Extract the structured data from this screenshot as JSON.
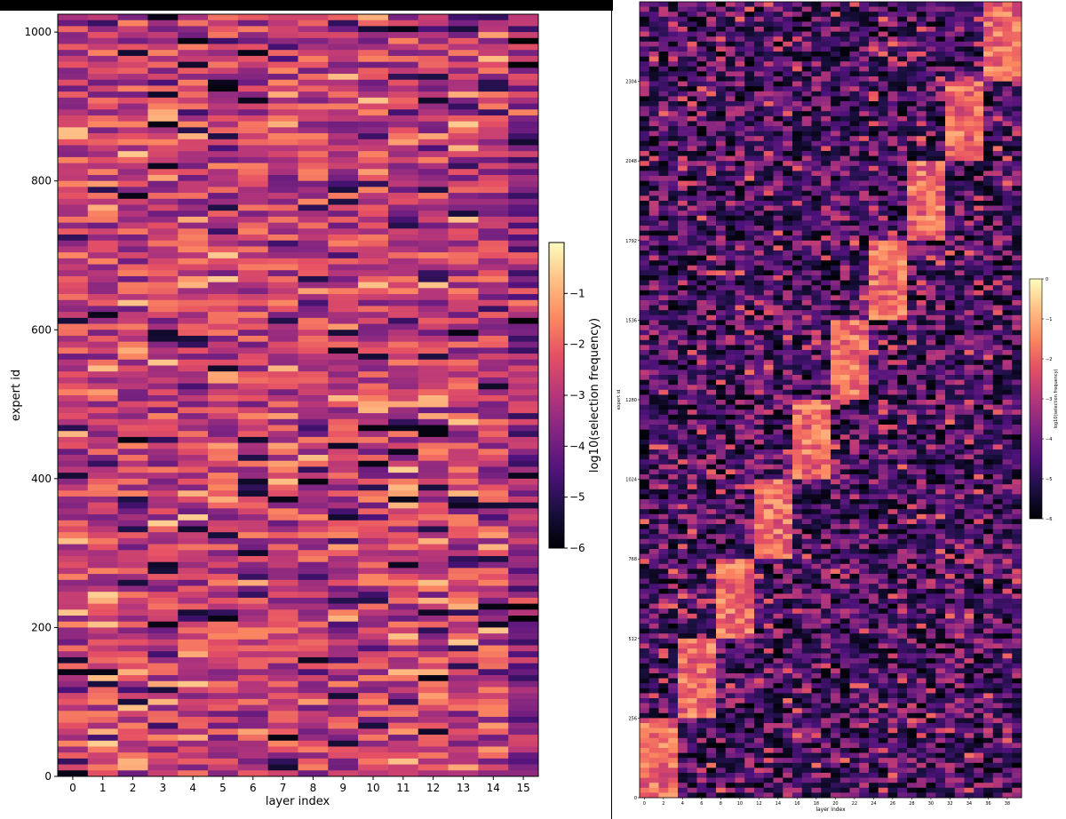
{
  "chart_data": [
    {
      "type": "heatmap",
      "xlabel": "layer index",
      "ylabel": "expert id",
      "x_tick_labels": [
        "0",
        "1",
        "2",
        "3",
        "4",
        "5",
        "6",
        "7",
        "8",
        "9",
        "10",
        "11",
        "12",
        "13",
        "14",
        "15"
      ],
      "y_tick_labels": [
        "0",
        "200",
        "400",
        "600",
        "800",
        "1000"
      ],
      "y_ticks": [
        0,
        200,
        400,
        600,
        800,
        1000
      ],
      "xlim": [
        -0.5,
        15.5
      ],
      "ylim": [
        0,
        1024
      ],
      "colormap": "magma",
      "colorbar": {
        "label": "log10(selection frequency)",
        "tick_labels": [
          "−1",
          "−2",
          "−3",
          "−4",
          "−5",
          "−6"
        ],
        "ticks": [
          -1,
          -2,
          -3,
          -4,
          -5,
          -6
        ],
        "range": [
          -6,
          0
        ]
      },
      "pattern": "uniform usage across all experts in every layer; values mostly between -4 and -1.5, last layer slightly darker"
    },
    {
      "type": "heatmap",
      "xlabel": "layer index",
      "ylabel": "expert id",
      "x_tick_labels": [
        "0",
        "2",
        "4",
        "6",
        "8",
        "10",
        "12",
        "14",
        "16",
        "18",
        "20",
        "22",
        "24",
        "26",
        "28",
        "30",
        "32",
        "34",
        "36",
        "38"
      ],
      "y_tick_labels": [
        "0",
        "256",
        "512",
        "768",
        "1024",
        "1280",
        "1536",
        "1792",
        "2048",
        "2304"
      ],
      "y_ticks": [
        0,
        256,
        512,
        768,
        1024,
        1280,
        1536,
        1792,
        2048,
        2304
      ],
      "xlim": [
        -0.5,
        39.5
      ],
      "ylim": [
        0,
        2560
      ],
      "colormap": "magma",
      "colorbar": {
        "label": "log10(selection frequency)",
        "tick_labels": [
          "0",
          "−1",
          "−2",
          "−3",
          "−4",
          "−5",
          "−6"
        ],
        "ticks": [
          0,
          -1,
          -2,
          -3,
          -4,
          -5,
          -6
        ],
        "range": [
          -6,
          0
        ]
      },
      "pattern": "block-diagonal: each group of 4 layers strongly uses one block of 256 experts",
      "blocks": [
        {
          "layers": [
            0,
            3
          ],
          "experts": [
            0,
            256
          ]
        },
        {
          "layers": [
            4,
            7
          ],
          "experts": [
            256,
            512
          ]
        },
        {
          "layers": [
            8,
            11
          ],
          "experts": [
            512,
            768
          ]
        },
        {
          "layers": [
            12,
            15
          ],
          "experts": [
            768,
            1024
          ]
        },
        {
          "layers": [
            16,
            19
          ],
          "experts": [
            1024,
            1280
          ]
        },
        {
          "layers": [
            20,
            23
          ],
          "experts": [
            1280,
            1536
          ]
        },
        {
          "layers": [
            24,
            27
          ],
          "experts": [
            1536,
            1792
          ]
        },
        {
          "layers": [
            28,
            31
          ],
          "experts": [
            1792,
            2048
          ]
        },
        {
          "layers": [
            32,
            35
          ],
          "experts": [
            2048,
            2304
          ]
        },
        {
          "layers": [
            36,
            39
          ],
          "experts": [
            2304,
            2560
          ]
        }
      ]
    }
  ]
}
